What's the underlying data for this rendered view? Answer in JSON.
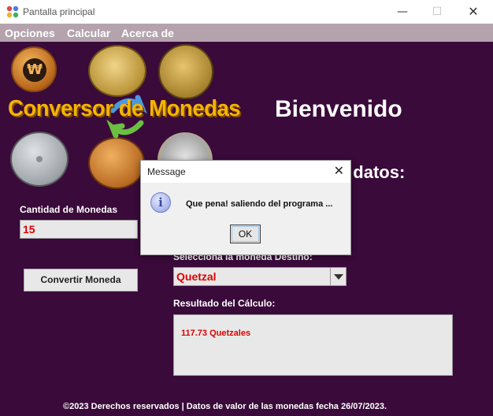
{
  "window": {
    "title": "Pantalla principal",
    "minimize_glyph": "—",
    "maximize_glyph": "☐",
    "close_glyph": "✕"
  },
  "menu": {
    "items": [
      {
        "label": "Opciones"
      },
      {
        "label": "Calcular"
      },
      {
        "label": "Acerca de"
      }
    ]
  },
  "header": {
    "logo_text": "Conversor de Monedas",
    "welcome": "Bienvenido",
    "datos_heading": "Ingrese los datos:"
  },
  "form": {
    "cantidad_label": "Cantidad de Monedas",
    "cantidad_value": "15",
    "convert_button": "Convertir Moneda",
    "destino_label": "Selecciona la moneda Destino:",
    "destino_value": "Quetzal",
    "resultado_label": "Resultado del Cálculo:",
    "resultado_value": "117.73 Quetzales"
  },
  "footer": {
    "text": "©2023 Derechos reservados | Datos de valor de las monedas fecha 26/07/2023."
  },
  "dialog": {
    "title": "Message",
    "close_glyph": "✕",
    "icon_glyph": "i",
    "message": "Que pena! saliendo del programa ...",
    "ok_button": "OK"
  },
  "coins": {
    "won_symbol": "₩"
  },
  "colors": {
    "background": "#3a0a3a",
    "menubar": "#b4a3ad",
    "logo": "#f5b400",
    "value_text": "#e00000"
  }
}
